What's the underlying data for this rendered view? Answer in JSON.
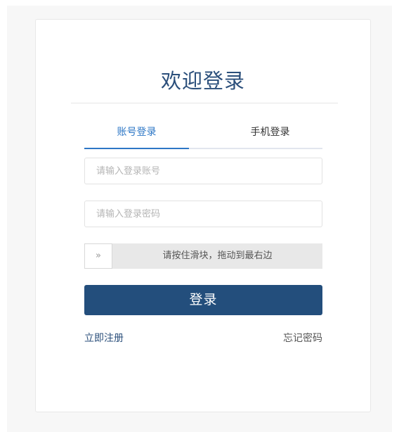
{
  "login": {
    "title": "欢迎登录",
    "tabs": {
      "account_label": "账号登录",
      "phone_label": "手机登录",
      "active": "账号登录"
    },
    "account_field": {
      "value": "",
      "placeholder": "请输入登录账号"
    },
    "password_field": {
      "value": "",
      "placeholder": "请输入登录密码"
    },
    "slider": {
      "handle_icon": "double-chevron-right-icon",
      "handle_glyph": "»",
      "text": "请按住滑块，拖动到最右边"
    },
    "submit_label": "登录",
    "register_link": "立即注册",
    "forgot_link": "忘记密码"
  },
  "colors": {
    "accent": "#2d77c6",
    "primary_button": "#234e7c",
    "title": "#2b4f7b"
  }
}
